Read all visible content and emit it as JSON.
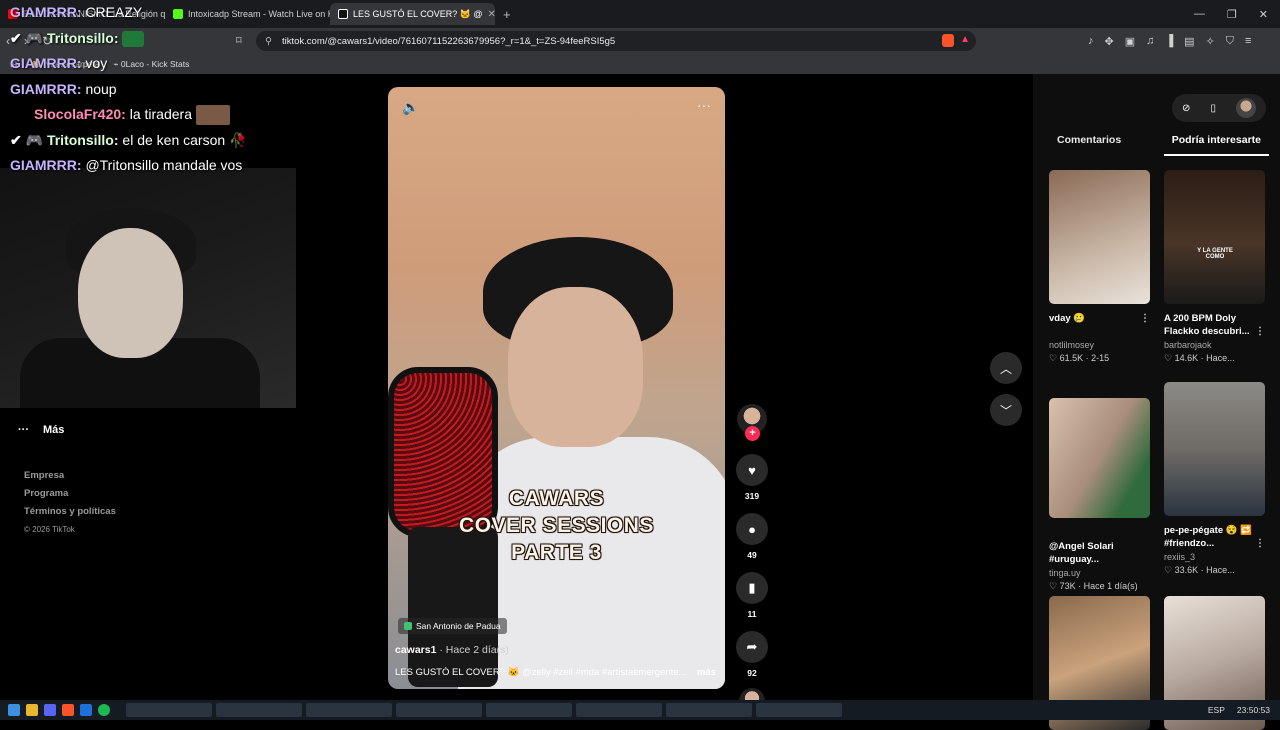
{
  "browser": {
    "tabs": [
      {
        "label": "RASTAFARIANISMO: La Religión que",
        "color": "#ff0000"
      },
      {
        "label": "Intoxicadp Stream - Watch Live on K",
        "color": "#53fc18"
      },
      {
        "label": "LES GUSTÓ EL COVER? 🐱 @",
        "color": "#ffffff"
      }
    ],
    "url": "tiktok.com/@cawars1/video/7616071152263679956?_r=1&_t=ZS-94feeRSI5g5",
    "bookmarks": [
      "Nueva carpeta",
      "0Laco - Kick Stats"
    ]
  },
  "chat": [
    {
      "user": "GIAMRRR:",
      "text": "CREAZY",
      "cls": "u"
    },
    {
      "user": "Tritonsillo:",
      "text": "",
      "cls": "u2",
      "prefix": "✔ 🎮 "
    },
    {
      "user": "GIAMRRR:",
      "text": "voy",
      "cls": "u"
    },
    {
      "user": "GIAMRRR:",
      "text": "noup",
      "cls": "u"
    },
    {
      "user": "SlocolaFr420:",
      "text": "la tiradera",
      "cls": "u3"
    },
    {
      "user": "Tritonsillo:",
      "text": "el de ken carson",
      "cls": "u2",
      "prefix": "✔ 🎮 "
    },
    {
      "user": "GIAMRRR:",
      "text": "@Tritonsillo mandale vos",
      "cls": "u"
    }
  ],
  "sidebar": {
    "more_label": "Más",
    "links": [
      "Empresa",
      "Programa",
      "Términos y políticas"
    ],
    "copyright": "© 2026 TikTok"
  },
  "video": {
    "overlay_title": [
      "CAWARS",
      "COVER SESSIONS",
      "PARTE 3"
    ],
    "location": "San Antonio de Padua",
    "author": "cawars1",
    "posted": "· Hace 2 día(s)",
    "caption": "LES GUSTÓ EL COVER? 🐱 @zelly #zell #mda #artistaemergente...",
    "more": "más"
  },
  "actions": {
    "likes": "319",
    "comments": "49",
    "saves": "11",
    "shares": "92"
  },
  "panel": {
    "tabs": [
      "Comentarios",
      "Podría interesarte"
    ],
    "cards": [
      {
        "title": "vday 🥲",
        "user": "notlilmosey",
        "stat": "♡ 61.5K · 2-15",
        "thumb": "#7a5a4a"
      },
      {
        "title": "A 200 BPM Doly Flackko descubri...",
        "user": "barbarojaok",
        "stat": "♡ 14.6K · Hace...",
        "thumb": "#3a2a22"
      },
      {
        "title": "@Angel Solari #uruguay...",
        "user": "tinga.uy",
        "stat": "♡ 73K · Hace 1 día(s)",
        "thumb": "#b9a08c"
      },
      {
        "title": "pe-pe-pégate 😵 🔁 #friendzo...",
        "user": "rexiis_3",
        "stat": "♡ 33.6K · Hace...",
        "thumb": "#8a7f74"
      },
      {
        "title": "",
        "user": "",
        "stat": "",
        "thumb": "#6b5a48"
      },
      {
        "title": "",
        "user": "",
        "stat": "",
        "thumb": "#d8cfc6"
      }
    ]
  },
  "taskbar": {
    "lang": "ESP",
    "time": "23:50:53"
  }
}
